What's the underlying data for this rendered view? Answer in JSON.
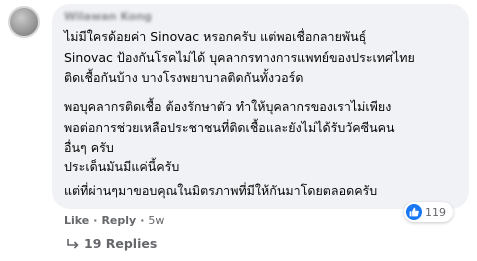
{
  "comment": {
    "author": "Wilawan Kong",
    "paragraphs": [
      [
        "ไม่มีใครด้อยค่า Sinovac หรอกครับ แต่พอเชื่อกลายพันธุ์",
        "Sinovac ป้องกันโรคไม่ได้ บุคลากรทางการแพทย์ของประเทศไทย",
        "ติดเชื้อกันบ้าง บางโรงพยาบาลติดกันทั้งวอร์ด"
      ],
      [
        "พอบุคลากรติดเชื้อ ต้องรักษาตัว ทำให้บุคลากรของเราไม่เพียง",
        "พอต่อการช่วยเหลือประชาชนที่ติดเชื้อและยังไม่ได้รับวัคซีนคน",
        "อื่นๆ ครับ"
      ],
      [
        "ประเด็นมันมีแค่นี้ครับ"
      ],
      [
        "แต่ที่ผ่านๆมาขอบคุณในมิตรภาพที่มีให้กันมาโดยตลอดครับ"
      ]
    ]
  },
  "reactions": {
    "icon": "thumbs-up-icon",
    "count": "119"
  },
  "actions": {
    "like": "Like",
    "separator": "·",
    "reply": "Reply",
    "time": "5w"
  },
  "replies": {
    "label": "19 Replies",
    "icon": "reply-arrow-icon"
  },
  "colors": {
    "bubble": "#f0f2f5",
    "accent": "#1877f2",
    "muted": "#65676b",
    "text": "#050505"
  }
}
